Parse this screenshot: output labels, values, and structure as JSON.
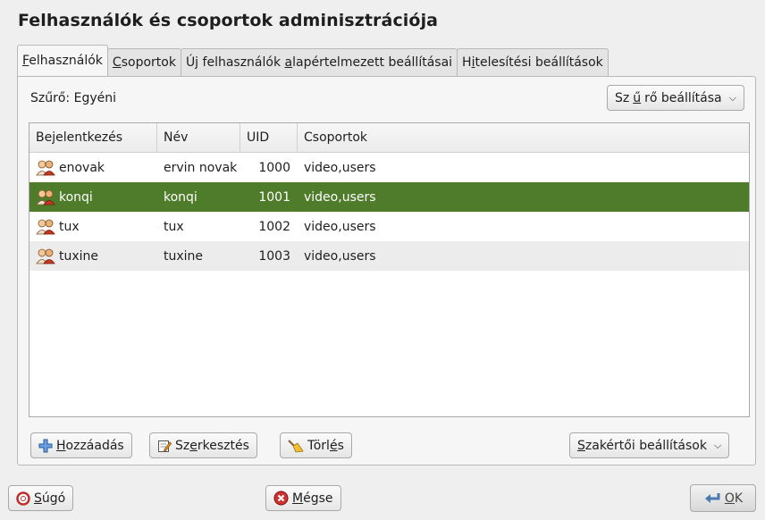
{
  "window": {
    "title": "Felhasználók és csoportok adminisztrációja"
  },
  "tabs": [
    {
      "label": "Felhasználók",
      "accel": "F",
      "rest": "elhasználók"
    },
    {
      "label": "Csoportok",
      "accel": "C",
      "rest": "soportok"
    },
    {
      "label": "Új felhasználók alapértelmezett beállításai",
      "pre": "Új felhasználók ",
      "accel": "a",
      "rest": "lapértelmezett beállításai"
    },
    {
      "label": "Hitelesítési beállítások",
      "pre": "H",
      "accel": "i",
      "rest": "telesítési beállítások"
    }
  ],
  "filter": {
    "label": "Szűrő: Egyéni",
    "button": "Szűrő beállítása",
    "btn_pre": "Sz",
    "btn_accel": "ű",
    "btn_rest": "rő beállítása"
  },
  "table": {
    "columns": [
      "Bejelentkezés",
      "Név",
      "UID",
      "Csoportok"
    ],
    "rows": [
      {
        "login": "enovak",
        "name": "ervin novak",
        "uid": "1000",
        "groups": "video,users"
      },
      {
        "login": "konqi",
        "name": "konqi",
        "uid": "1001",
        "groups": "video,users"
      },
      {
        "login": "tux",
        "name": "tux",
        "uid": "1002",
        "groups": "video,users"
      },
      {
        "login": "tuxine",
        "name": "tuxine",
        "uid": "1003",
        "groups": "video,users"
      }
    ],
    "selected_row": 1
  },
  "actions": {
    "add": {
      "label": "Hozzáadás",
      "accel": "H",
      "rest": "ozzáadás"
    },
    "edit": {
      "label": "Szerkesztés",
      "pre": "Sz",
      "accel": "e",
      "rest": "rkesztés"
    },
    "delete": {
      "label": "Törlés",
      "pre": "Törl",
      "accel": "é",
      "rest": "s"
    },
    "expert": {
      "label": "Szakértői beállítások",
      "accel": "S",
      "rest": "zakértői beállítások"
    }
  },
  "footer": {
    "help": {
      "label": "Súgó",
      "accel": "S",
      "rest": "úgó"
    },
    "cancel": {
      "label": "Mégse",
      "accel": "M",
      "rest": "égse"
    },
    "ok": {
      "label": "OK",
      "accel": "O",
      "rest": "K"
    }
  },
  "colors": {
    "selection": "#4f7c2a",
    "alt_row": "#ececec"
  },
  "icons": {
    "user": "users-icon",
    "add": "plus-icon",
    "edit": "edit-icon",
    "delete": "broom-icon",
    "help": "help-icon",
    "cancel": "cancel-icon",
    "ok": "ok-arrow-icon"
  }
}
